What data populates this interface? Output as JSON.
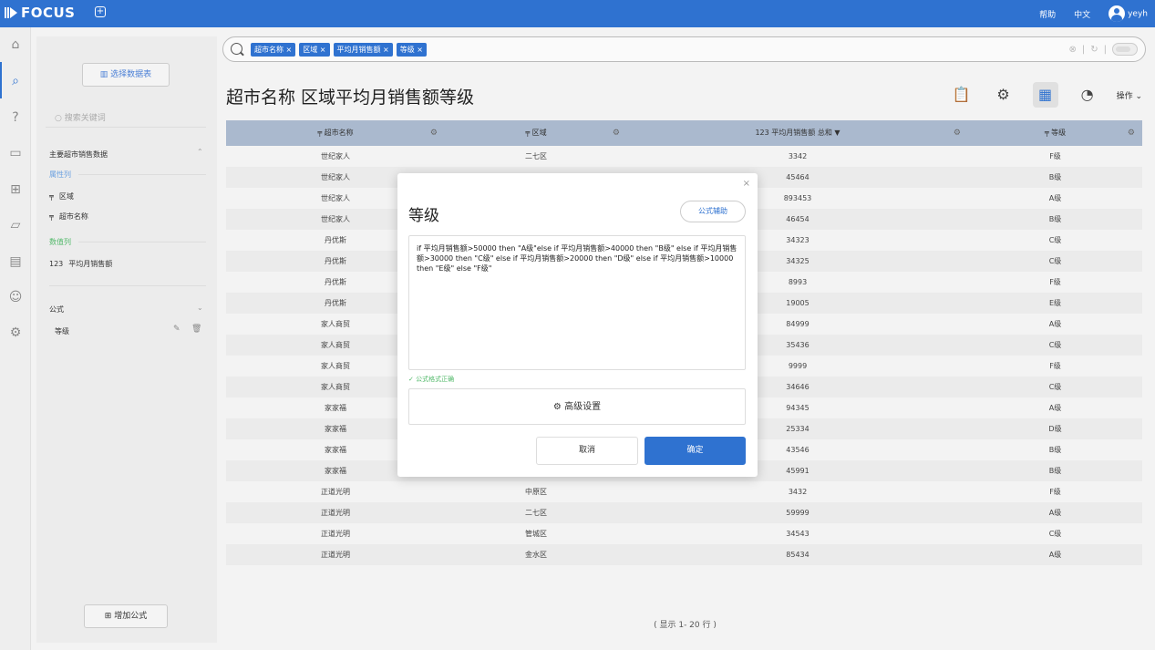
{
  "app": {
    "logo": "FOCUS"
  },
  "topbar": {
    "help": "帮助",
    "language": "中文",
    "user": "yeyh"
  },
  "sidebar": {
    "select_table": "选择数据表",
    "search_placeholder": "搜索关键词",
    "table_name": "主要超市销售数据",
    "attr_label": "属性列",
    "attr_items": [
      {
        "icon": "text-column-icon",
        "label": "区域"
      },
      {
        "icon": "text-column-icon",
        "label": "超市名称"
      }
    ],
    "value_label": "数值列",
    "value_items": [
      {
        "icon_text": "123",
        "label": "平均月销售额"
      }
    ],
    "formula_label": "公式",
    "formula_items": [
      {
        "label": "等级"
      }
    ],
    "add_formula": "增加公式"
  },
  "search": {
    "tokens": [
      "超市名称 ×",
      "区域 ×",
      "平均月销售额 ×",
      "等级 ×"
    ]
  },
  "page_title": "超市名称 区域平均月销售额等级",
  "toolbar": {
    "operate": "操作"
  },
  "table": {
    "headers": [
      "超市名称",
      "区域",
      "123 平均月销售额 总和 ▼",
      "等级"
    ],
    "rows": [
      [
        "世纪家人",
        "二七区",
        "3342",
        "F级"
      ],
      [
        "世纪家人",
        "",
        "45464",
        "B级"
      ],
      [
        "世纪家人",
        "",
        "893453",
        "A级"
      ],
      [
        "世纪家人",
        "",
        "46454",
        "B级"
      ],
      [
        "丹优斯",
        "",
        "34323",
        "C级"
      ],
      [
        "丹优斯",
        "",
        "34325",
        "C级"
      ],
      [
        "丹优斯",
        "",
        "8993",
        "F级"
      ],
      [
        "丹优斯",
        "",
        "19005",
        "E级"
      ],
      [
        "家人商贸",
        "",
        "84999",
        "A级"
      ],
      [
        "家人商贸",
        "",
        "35436",
        "C级"
      ],
      [
        "家人商贸",
        "",
        "9999",
        "F级"
      ],
      [
        "家人商贸",
        "",
        "34646",
        "C级"
      ],
      [
        "家家福",
        "",
        "94345",
        "A级"
      ],
      [
        "家家福",
        "",
        "25334",
        "D级"
      ],
      [
        "家家福",
        "",
        "43546",
        "B级"
      ],
      [
        "家家福",
        "",
        "45991",
        "B级"
      ],
      [
        "正道光明",
        "中原区",
        "3432",
        "F级"
      ],
      [
        "正道光明",
        "二七区",
        "59999",
        "A级"
      ],
      [
        "正道光明",
        "管城区",
        "34543",
        "C级"
      ],
      [
        "正道光明",
        "金水区",
        "85434",
        "A级"
      ]
    ],
    "footer": "( 显示 1- 20 行 )"
  },
  "dialog": {
    "title": "等级",
    "assist": "公式辅助",
    "formula": "if 平均月销售额>50000 then \"A级\"else if 平均月销售额>40000 then \"B级\" else if 平均月销售额>30000 then \"C级\" else if 平均月销售额>20000 then \"D级\" else if 平均月销售额>10000 then \"E级\" else \"F级\"",
    "status": "公式格式正确",
    "advanced": "高级设置",
    "cancel": "取消",
    "confirm": "确定"
  }
}
